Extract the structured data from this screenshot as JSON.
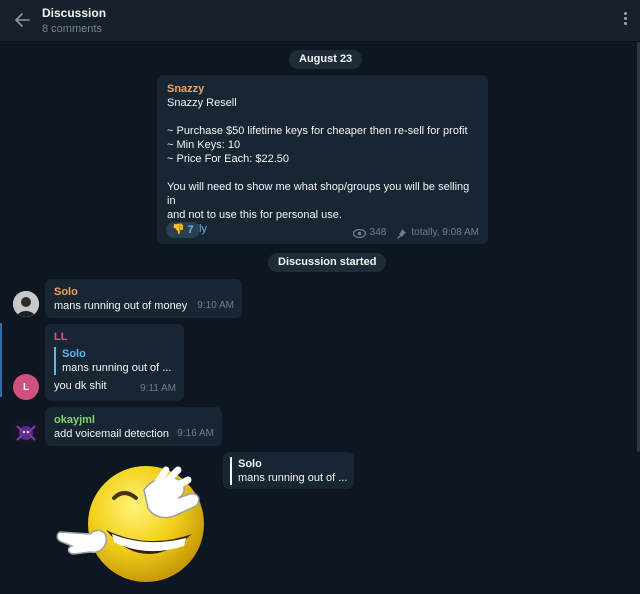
{
  "header": {
    "title": "Discussion",
    "subtitle": "8 comments"
  },
  "date_pill": "August 23",
  "post": {
    "author": "Snazzy",
    "lines": [
      "Snazzy Resell",
      "",
      "~ Purchase $50 lifetime keys for cheaper then re-sell for profit",
      "~ Min Keys: 10",
      "~ Price For Each: $22.50",
      "",
      "You will need to show me what shop/groups you will be selling in",
      "and not to use this for personal use."
    ],
    "mention": "@totally",
    "reaction": {
      "emoji": "thumbs-down",
      "count": "7"
    },
    "views": "348",
    "signature": "totally, 9:08 AM"
  },
  "discussion_pill": "Discussion started",
  "messages": [
    {
      "author": "Solo",
      "author_color": "#f1a35d",
      "text": "mans running out of money",
      "time": "9:10 AM"
    },
    {
      "author": "LL",
      "author_color": "#e1567c",
      "avatar_letter": "L",
      "reply": {
        "author": "Solo",
        "text": "mans running out of ..."
      },
      "text": "you dk shit",
      "time": "9:11 AM"
    },
    {
      "author": "okayjml",
      "author_color": "#7fd36e",
      "text": "add voicemail detection",
      "time": "9:16 AM"
    }
  ],
  "sticker_reply": {
    "author": "Solo",
    "text": "mans running out of ..."
  },
  "colors": {
    "background": "#0e1621",
    "bubble": "#182533",
    "accent": "#5eb5f7",
    "header": "#17212b"
  }
}
